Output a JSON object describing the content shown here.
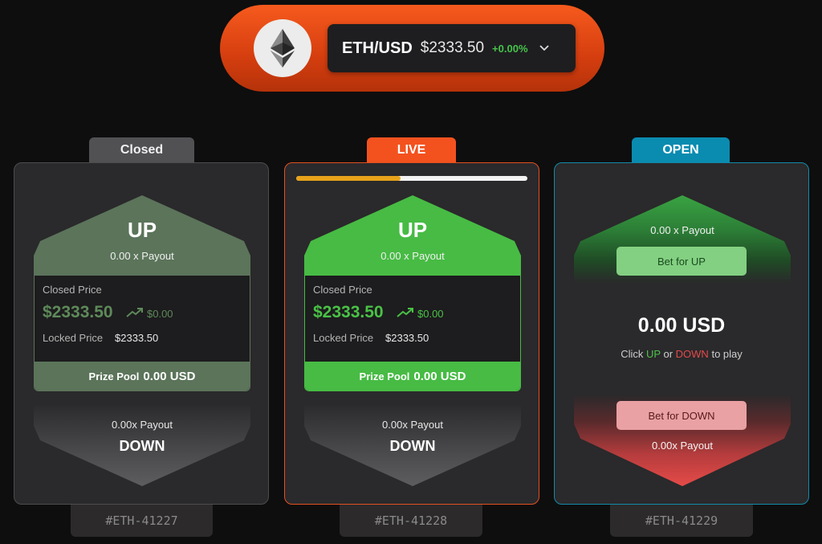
{
  "header": {
    "logo_icon": "ethereum-icon",
    "pair": "ETH/USD",
    "price": "$2333.50",
    "change": "+0.00%",
    "change_color": "#46c34a",
    "accent": "#f65a1d"
  },
  "rounds": [
    {
      "status": "Closed",
      "up_title": "UP",
      "up_payout": "0.00 x Payout",
      "closed_price_label": "Closed Price",
      "closed_price": "$2333.50",
      "delta": "$0.00",
      "locked_price_label": "Locked Price",
      "locked_price": "$2333.50",
      "prize_pool_label": "Prize Pool",
      "prize_pool": "0.00 USD",
      "down_payout": "0.00x Payout",
      "down_title": "DOWN",
      "round_id": "#ETH-41227"
    },
    {
      "status": "LIVE",
      "progress": 0.45,
      "up_title": "UP",
      "up_payout": "0.00 x Payout",
      "closed_price_label": "Closed Price",
      "closed_price": "$2333.50",
      "delta": "$0.00",
      "locked_price_label": "Locked Price",
      "locked_price": "$2333.50",
      "prize_pool_label": "Prize Pool",
      "prize_pool": "0.00 USD",
      "down_payout": "0.00x Payout",
      "down_title": "DOWN",
      "round_id": "#ETH-41228"
    },
    {
      "status": "OPEN",
      "up_payout": "0.00 x Payout",
      "bet_up": "Bet for UP",
      "amount": "0.00 USD",
      "hint_pre": "Click",
      "hint_up": "UP",
      "hint_or": "or",
      "hint_down": "DOWN",
      "hint_post": "to play",
      "bet_down": "Bet for DOWN",
      "down_payout": "0.00x Payout",
      "round_id": "#ETH-41229"
    }
  ]
}
